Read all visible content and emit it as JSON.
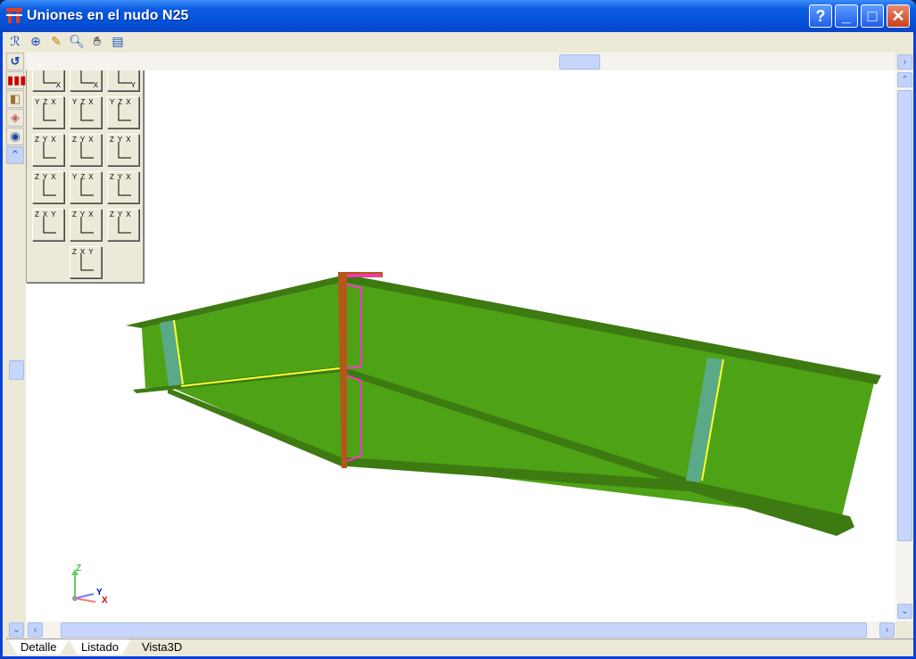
{
  "window": {
    "title": "Uniones en el nudo N25",
    "buttons": {
      "help": "?",
      "minimize": "_",
      "maximize": "□",
      "close": "✕"
    }
  },
  "toolbar": {
    "icons": [
      "rotate-zoom-icon",
      "zoom-window-icon",
      "pencil-icon",
      "zoom-icon",
      "pan-hand-icon",
      "refresh-view-icon"
    ]
  },
  "left_tools": {
    "icons": [
      "rotate-icon",
      "bar-chart-icon",
      "cube-icon",
      "cube-rotate-icon",
      "eye-icon"
    ]
  },
  "view_panel": {
    "buttons": [
      [
        "Z",
        "X"
      ],
      [
        "Y",
        "X"
      ],
      [
        "Z",
        "Y"
      ],
      [
        "YZX"
      ],
      [
        "YZX"
      ],
      [
        "YZX"
      ],
      [
        "ZYX"
      ],
      [
        "ZYX"
      ],
      [
        "ZYX"
      ],
      [
        "ZYX"
      ],
      [
        "YZX"
      ],
      [
        "ZYX"
      ],
      [
        "ZXY"
      ],
      [
        "ZYX"
      ],
      [
        "ZYX"
      ],
      [
        "ZXY"
      ]
    ]
  },
  "axes": {
    "x": "X",
    "y": "Y",
    "z": "Z"
  },
  "tabs": [
    {
      "label": "Detalle"
    },
    {
      "label": "Listado"
    },
    {
      "label": "Vista3D"
    }
  ],
  "colors": {
    "beam": "#4ea215",
    "beam_dark": "#3d7a12",
    "plate": "#b5561a",
    "stiffener": "#5aaa88",
    "weld": "#ffff33",
    "bolt_weld": "#ff33cc"
  }
}
